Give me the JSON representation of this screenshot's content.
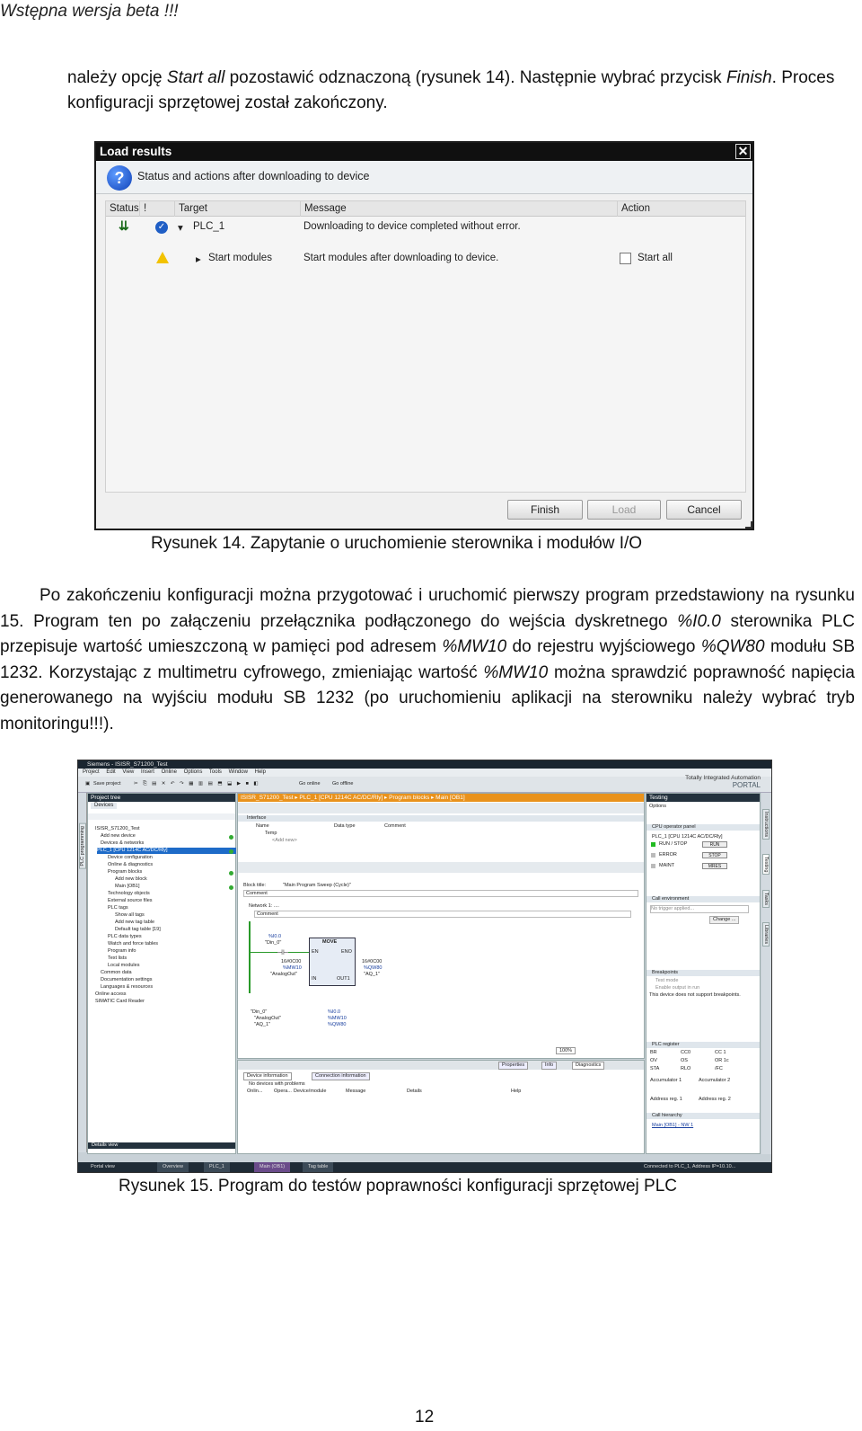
{
  "page": {
    "header": "Wstępna wersja beta !!!",
    "para1": {
      "a": "należy opcję ",
      "b": "Start all",
      "c": " pozostawić odznaczoną (rysunek 14). Następnie wybrać przycisk ",
      "d": "Finish",
      "e": ". Proces konfiguracji sprzętowej został zakończony."
    },
    "caption14": "Rysunek 14. Zapytanie o uruchomienie sterownika i modułów I/O",
    "para2": {
      "t1": "Po zakończeniu konfiguracji można przygotować i uruchomić pierwszy program przedstawiony na rysunku 15. Program ten po załączeniu przełącznika podłączonego do wejścia dyskretnego ",
      "i1": "%I0.0",
      "t2": " sterownika PLC przepisuje wartość umieszczoną w pamięci pod adresem ",
      "i2": "%MW10",
      "t3": " do rejestru wyjściowego ",
      "i3": "%QW80",
      "t4": " modułu SB 1232. Korzystając z multimetru cyfrowego, zmieniając wartość ",
      "i4": "%MW10",
      "t5": " można sprawdzić poprawność napięcia generowanego na wyjściu modułu SB 1232 (po uruchomieniu aplikacji na sterowniku należy wybrać tryb monitoringu!!!)."
    },
    "caption15": "Rysunek 15. Program do testów poprawności konfiguracji sprzętowej PLC",
    "page_number": "12"
  },
  "dialog": {
    "title": "Load results",
    "subtitle": "Status and actions after downloading to device",
    "columns": [
      "Status",
      "!",
      "Target",
      "Message",
      "Action"
    ],
    "rows": [
      {
        "target": "PLC_1",
        "message": "Downloading to device completed without error.",
        "action": ""
      },
      {
        "target": "Start modules",
        "message": "Start modules after downloading to device.",
        "action": "Start all"
      }
    ],
    "buttons": {
      "finish": "Finish",
      "load": "Load",
      "cancel": "Cancel"
    }
  },
  "tia": {
    "title": "Siemens - ISISR_S71200_Test",
    "menu": [
      "Project",
      "Edit",
      "View",
      "Insert",
      "Online",
      "Options",
      "Tools",
      "Window",
      "Help"
    ],
    "toolbar": {
      "save": "Save project",
      "go_online": "Go online",
      "go_offline": "Go offline"
    },
    "brand_line1": "Totally Integrated Automation",
    "brand_line2": "PORTAL",
    "project_tree": {
      "header": "Project tree",
      "devices_tab": "Devices",
      "items": [
        "ISISR_S71200_Test",
        "Add new device",
        "Devices & networks",
        "PLC_1 [CPU 1214C AC/DC/Rly]",
        "Device configuration",
        "Online & diagnostics",
        "Program blocks",
        "Add new block",
        "Main [OB1]",
        "Technology objects",
        "External source files",
        "PLC tags",
        "Show all tags",
        "Add new tag table",
        "Default tag table [19]",
        "PLC data types",
        "Watch and force tables",
        "Program info",
        "Text lists",
        "Local modules",
        "Common data",
        "Documentation settings",
        "Languages & resources",
        "Online access",
        "SIMATIC Card Reader"
      ],
      "details_view": "Details view",
      "side_tab": "PLC programming"
    },
    "editor": {
      "breadcrumb": "ISISR_S71200_Test ▸ PLC_1 [CPU 1214C AC/DC/Rly] ▸ Program blocks ▸ Main [OB1]",
      "interface_label": "Interface",
      "iface_cols": [
        "Name",
        "Data type",
        "Comment"
      ],
      "iface_rows": [
        "Temp",
        "<Add new>"
      ],
      "block_title": "Block title:",
      "block_title_value": "\"Main Program Sweep (Cycle)\"",
      "comment": "Comment",
      "network": "Network 1: ....",
      "network_comment": "Comment",
      "contact_addr": "%I0.0",
      "contact_name": "\"Din_0\"",
      "move_label": "MOVE",
      "en": "EN",
      "eno": "ENO",
      "in_val": "16#0C00",
      "in_addr": "%MW10",
      "in_name": "\"AnalogOut\"",
      "in_pin": "IN",
      "out_pin": "OUT1",
      "out_val": "16#0C00",
      "out_addr": "%QW80",
      "out_name": "\"AQ_1\"",
      "symbols": [
        {
          "name": "\"Din_0\"",
          "addr": "%I0.0"
        },
        {
          "name": "\"AnalogOut\"",
          "addr": "%MW10"
        },
        {
          "name": "\"AQ_1\"",
          "addr": "%QW80"
        }
      ],
      "zoom": "100%"
    },
    "inspector": {
      "tabs": [
        "Properties",
        "Info",
        "Diagnostics"
      ],
      "subtabs": [
        "Device information",
        "Connection information"
      ],
      "no_devices": "No devices with problems",
      "cols": [
        "Onlin...",
        "Opera...",
        "Device/module",
        "Message",
        "Details",
        "Help"
      ]
    },
    "testing": {
      "header": "Testing",
      "options": "Options",
      "cpu_panel": "CPU operator panel",
      "cpu_name": "PLC_1 [CPU 1214C AC/DC/Rly]",
      "leds": [
        "RUN / STOP",
        "ERROR",
        "MAINT"
      ],
      "btns": [
        "RUN",
        "STOP",
        "MRES"
      ],
      "call_env": "Call environment",
      "no_trigger": "No trigger applied...",
      "change": "Change ...",
      "breakpoints": "Breakpoints",
      "test_mode": "Test mode",
      "enable_output": "Enable output in run",
      "bp_note": "This device does not support breakpoints.",
      "plc_register": "PLC register",
      "reg_rows": [
        [
          "BR",
          "CC0",
          "CC 1"
        ],
        [
          "OV",
          "OS",
          "OR 1c"
        ],
        [
          "STA",
          "RLO",
          "/FC"
        ]
      ],
      "acc1": "Accumulator 1",
      "acc2": "Accumulator 2",
      "addr1": "Address reg. 1",
      "addr2": "Address reg. 2",
      "call_hier": "Call hierarchy",
      "call_link": "Main [OB1] - NW 1",
      "right_tabs": [
        "Instructions",
        "Testing",
        "Tasks",
        "Libraries"
      ]
    },
    "statusbar": {
      "portal_view": "Portal view",
      "tabs": [
        "Overview",
        "PLC_1",
        "Main (OB1)",
        "Tag table"
      ],
      "connected": "Connected to PLC_1, Address IP=10.10..."
    }
  }
}
